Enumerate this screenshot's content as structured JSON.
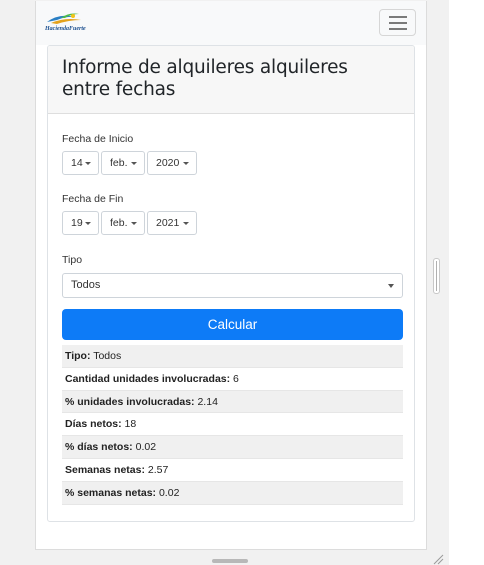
{
  "brand": {
    "logo_text": "HaciendaFuerte"
  },
  "page": {
    "title": "Informe de alquileres alquileres entre fechas"
  },
  "form": {
    "fecha_inicio": {
      "label": "Fecha de Inicio",
      "day": "14",
      "month": "feb.",
      "year": "2020"
    },
    "fecha_fin": {
      "label": "Fecha de Fin",
      "day": "19",
      "month": "feb.",
      "year": "2021"
    },
    "tipo": {
      "label": "Tipo",
      "value": "Todos"
    },
    "submit_label": "Calcular"
  },
  "results": [
    {
      "label": "Tipo:",
      "value": "Todos"
    },
    {
      "label": "Cantidad unidades involucradas:",
      "value": "6"
    },
    {
      "label": "% unidades involucradas:",
      "value": "2.14"
    },
    {
      "label": "Días netos:",
      "value": "18"
    },
    {
      "label": "% días netos:",
      "value": "0.02"
    },
    {
      "label": "Semanas netas:",
      "value": "2.57"
    },
    {
      "label": "% semanas netas:",
      "value": "0.02"
    }
  ],
  "colors": {
    "primary": "#0d7bf7",
    "navbar_bg": "#f8f9fa",
    "header_bg": "#f7f7f7"
  },
  "icons": {
    "menu": "hamburger-icon",
    "caret": "caret-down-icon"
  }
}
